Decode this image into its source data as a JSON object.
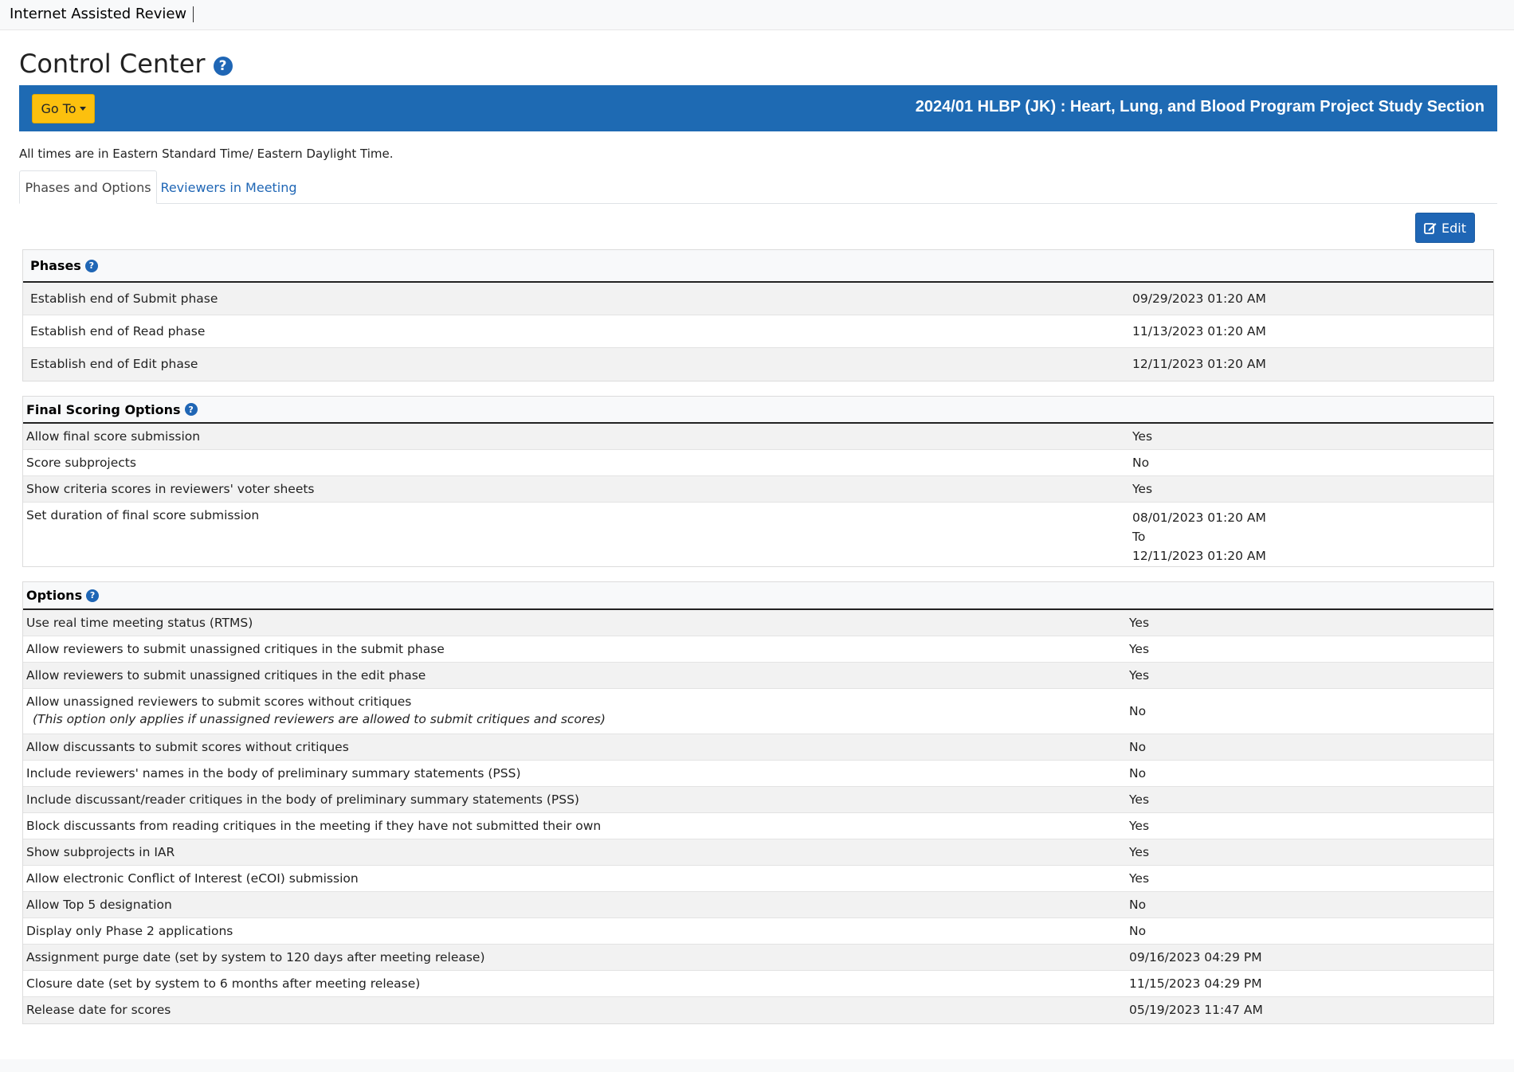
{
  "app": {
    "brand": "Internet Assisted Review"
  },
  "page": {
    "title": "Control Center"
  },
  "banner": {
    "goto_label": "Go To",
    "meeting_title": "2024/01 HLBP (JK) : Heart, Lung, and Blood Program Project Study Section"
  },
  "timezone_note": "All times are in Eastern Standard Time/ Eastern Daylight Time.",
  "tabs": [
    {
      "label": "Phases and Options",
      "active": true
    },
    {
      "label": "Reviewers in Meeting",
      "active": false
    }
  ],
  "toolbar": {
    "edit_label": "Edit"
  },
  "phases": {
    "header": "Phases",
    "rows": [
      {
        "label": "Establish end of Submit phase",
        "value": "09/29/2023 01:20 AM"
      },
      {
        "label": "Establish end of Read phase",
        "value": "11/13/2023 01:20 AM"
      },
      {
        "label": "Establish end of Edit phase",
        "value": "12/11/2023 01:20 AM"
      }
    ]
  },
  "final_scoring": {
    "header": "Final Scoring Options",
    "rows": [
      {
        "label": "Allow final score submission",
        "value": "Yes"
      },
      {
        "label": "Score subprojects",
        "value": "No"
      },
      {
        "label": "Show criteria scores in reviewers' voter sheets",
        "value": "Yes"
      }
    ],
    "duration": {
      "label": "Set duration of final score submission",
      "start": "08/01/2023 01:20 AM",
      "to": "To",
      "end": "12/11/2023 01:20 AM"
    }
  },
  "options": {
    "header": "Options",
    "rows": [
      {
        "label": "Use real time meeting status (RTMS)",
        "value": "Yes"
      },
      {
        "label": "Allow reviewers to submit unassigned critiques in the submit phase",
        "value": "Yes"
      },
      {
        "label": "Allow reviewers to submit unassigned critiques in the edit phase",
        "value": "Yes"
      },
      {
        "label": "Allow unassigned reviewers to submit scores without critiques",
        "note": "(This option only applies if unassigned reviewers are allowed to submit critiques and scores)",
        "value": "No"
      },
      {
        "label": "Allow discussants to submit scores without critiques",
        "value": "No"
      },
      {
        "label": "Include reviewers' names in the body of preliminary summary statements (PSS)",
        "value": "No"
      },
      {
        "label": "Include discussant/reader critiques in the body of preliminary summary statements (PSS)",
        "value": "Yes"
      },
      {
        "label": "Block discussants from reading critiques in the meeting if they have not submitted their own",
        "value": "Yes"
      },
      {
        "label": "Show subprojects in IAR",
        "value": "Yes"
      },
      {
        "label": "Allow electronic Conflict of Interest (eCOI) submission",
        "value": "Yes"
      },
      {
        "label": "Allow Top 5 designation",
        "value": "No"
      },
      {
        "label": "Display only Phase 2 applications",
        "value": "No"
      },
      {
        "label": "Assignment purge date (set by system to 120 days after meeting release)",
        "value": "09/16/2023 04:29 PM"
      },
      {
        "label": "Closure date (set by system to 6 months after meeting release)",
        "value": "11/15/2023 04:29 PM"
      },
      {
        "label": "Release date for scores",
        "value": "05/19/2023 11:47 AM"
      }
    ]
  },
  "colors": {
    "banner": "#1e6ab3",
    "goto_button": "#fcc00e",
    "edit_button": "#1f66b5",
    "help_icon": "#1f66b5",
    "link": "#1f66b5"
  }
}
